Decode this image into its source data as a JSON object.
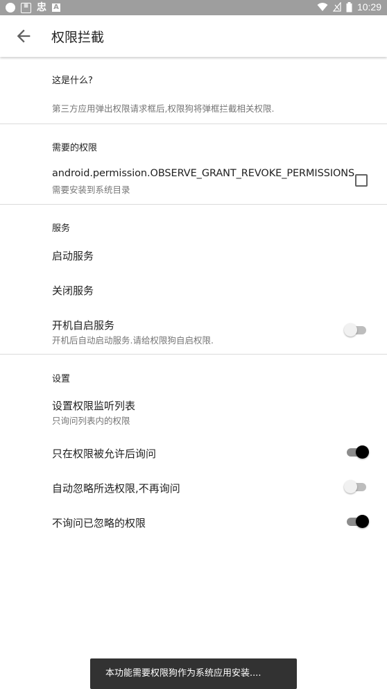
{
  "status_bar": {
    "time": "10:29",
    "icons": [
      "circle-notification-icon",
      "qr-notification-icon",
      "app-notification-icon",
      "a-notification-icon",
      "wifi-icon",
      "signal-icon",
      "battery-icon"
    ]
  },
  "app_bar": {
    "title": "权限拦截",
    "back_icon": "arrow-back-icon"
  },
  "sections": {
    "about": {
      "header": "这是什么?",
      "description": "第三方应用弹出权限请求框后,权限狗将弹框拦截相关权限."
    },
    "permissions": {
      "header": "需要的权限",
      "item_title": "android.permission.OBSERVE_GRANT_REVOKE_PERMISSIONS",
      "item_subtitle": "需要安装到系统目录",
      "checked": false
    },
    "service": {
      "header": "服务",
      "start": "启动服务",
      "stop": "关闭服务",
      "autostart_title": "开机自启服务",
      "autostart_subtitle": "开机后自动启动服务.请给权限狗自启权限.",
      "autostart_on": false
    },
    "settings": {
      "header": "设置",
      "listen_title": "设置权限监听列表",
      "listen_subtitle": "只询问列表内的权限",
      "ask_after_grant_title": "只在权限被允许后询问",
      "ask_after_grant_on": true,
      "auto_ignore_title": "自动忽略所选权限,不再询问",
      "auto_ignore_on": false,
      "skip_ignored_title": "不询问已忽略的权限",
      "skip_ignored_on": true
    }
  },
  "snackbar": {
    "message": "本功能需要权限狗作为系统应用安装...."
  },
  "colors": {
    "status_bar": "#9e9e9e",
    "switch_on_thumb": "#000000",
    "switch_off_thumb": "#f1f1f1",
    "snackbar": "#323232"
  }
}
